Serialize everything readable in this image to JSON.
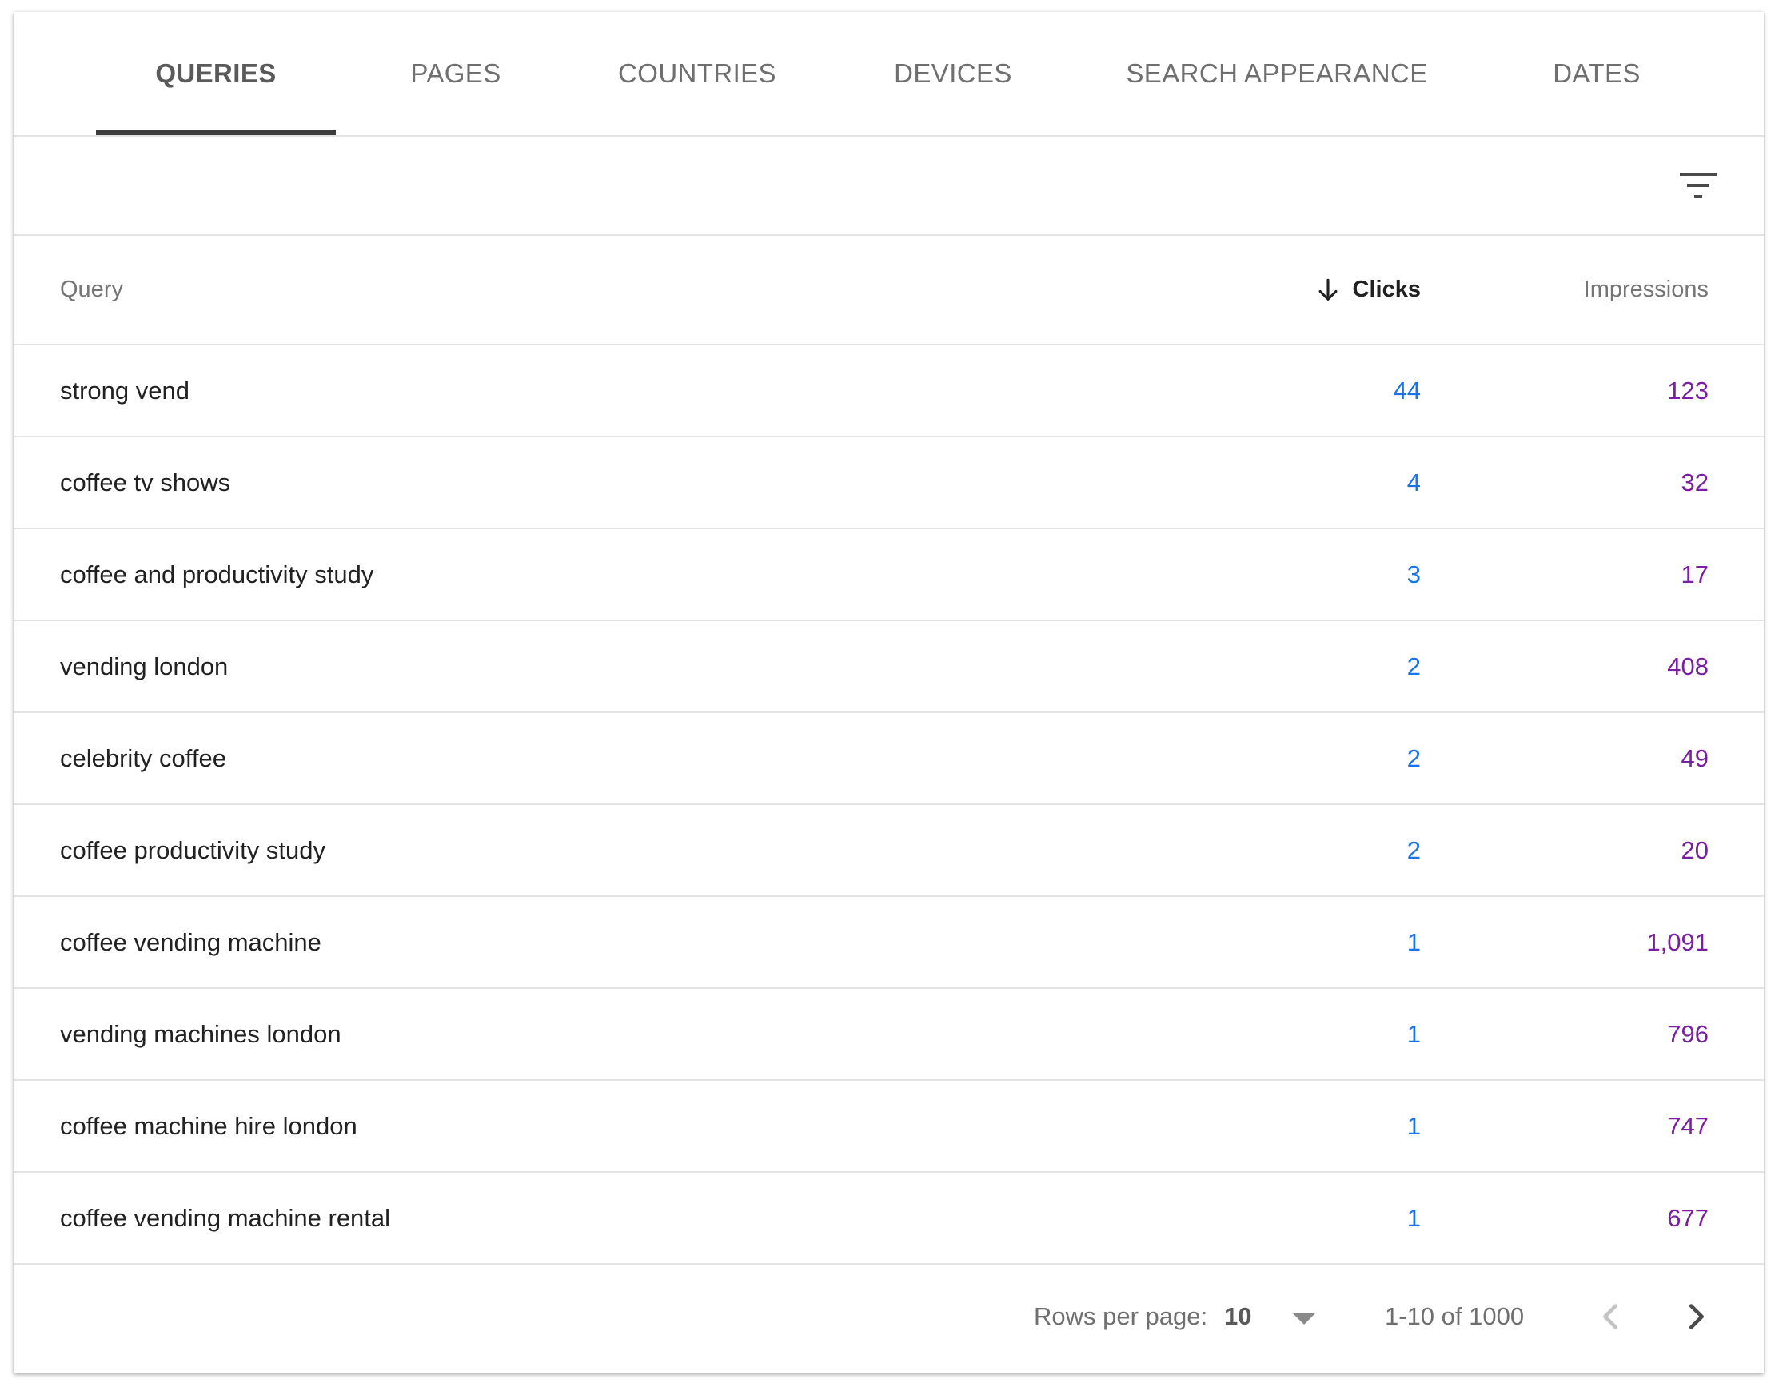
{
  "tabs": [
    {
      "label": "QUERIES",
      "active": true
    },
    {
      "label": "PAGES",
      "active": false
    },
    {
      "label": "COUNTRIES",
      "active": false
    },
    {
      "label": "DEVICES",
      "active": false
    },
    {
      "label": "SEARCH APPEARANCE",
      "active": false
    },
    {
      "label": "DATES",
      "active": false
    }
  ],
  "filter": {
    "icon": "filter-list-icon"
  },
  "table": {
    "columns": {
      "query": "Query",
      "clicks": "Clicks",
      "impressions": "Impressions"
    },
    "sorted_by": "Clicks",
    "sort_direction": "descending",
    "rows": [
      {
        "query": "strong vend",
        "clicks": "44",
        "impressions": "123"
      },
      {
        "query": "coffee tv shows",
        "clicks": "4",
        "impressions": "32"
      },
      {
        "query": "coffee and productivity study",
        "clicks": "3",
        "impressions": "17"
      },
      {
        "query": "vending london",
        "clicks": "2",
        "impressions": "408"
      },
      {
        "query": "celebrity coffee",
        "clicks": "2",
        "impressions": "49"
      },
      {
        "query": "coffee productivity study",
        "clicks": "2",
        "impressions": "20"
      },
      {
        "query": "coffee vending machine",
        "clicks": "1",
        "impressions": "1,091"
      },
      {
        "query": "vending machines london",
        "clicks": "1",
        "impressions": "796"
      },
      {
        "query": "coffee machine hire london",
        "clicks": "1",
        "impressions": "747"
      },
      {
        "query": "coffee vending machine rental",
        "clicks": "1",
        "impressions": "677"
      }
    ]
  },
  "pagination": {
    "rows_per_page_label": "Rows per page:",
    "rows_per_page_value": "10",
    "range_label": "1-10 of 1000",
    "prev_enabled": false,
    "next_enabled": true
  },
  "colors": {
    "clicks": "#1a73e8",
    "impressions": "#7b1fa2",
    "active_tab_underline": "#3c3c3c"
  }
}
